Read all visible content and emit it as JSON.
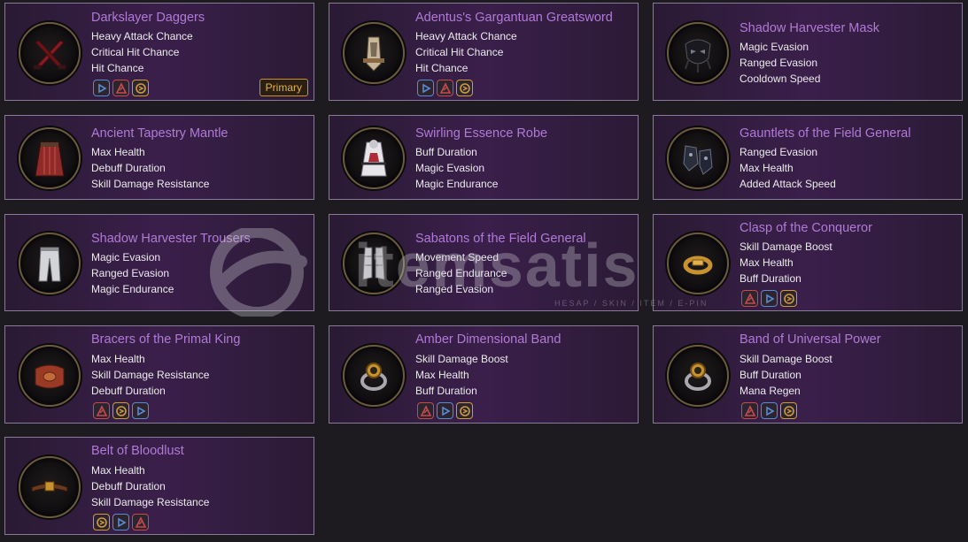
{
  "items": [
    {
      "name": "Darkslayer Daggers",
      "stats": [
        "Heavy Attack Chance",
        "Critical Hit Chance",
        "Hit Chance"
      ],
      "badges": [
        "blue",
        "red",
        "gold"
      ],
      "icon": "daggers-icon",
      "primary": "Primary"
    },
    {
      "name": "Adentus's Gargantuan Greatsword",
      "stats": [
        "Heavy Attack Chance",
        "Critical Hit Chance",
        "Hit Chance"
      ],
      "badges": [
        "blue",
        "red",
        "gold"
      ],
      "icon": "greatsword-icon"
    },
    {
      "name": "Shadow Harvester Mask",
      "stats": [
        "Magic Evasion",
        "Ranged Evasion",
        "Cooldown Speed"
      ],
      "badges": [],
      "icon": "mask-icon"
    },
    {
      "name": "Ancient Tapestry Mantle",
      "stats": [
        "Max Health",
        "Debuff Duration",
        "Skill Damage Resistance"
      ],
      "badges": [],
      "icon": "cloak-icon"
    },
    {
      "name": "Swirling Essence Robe",
      "stats": [
        "Buff Duration",
        "Magic Evasion",
        "Magic Endurance"
      ],
      "badges": [],
      "icon": "robe-icon"
    },
    {
      "name": "Gauntlets of the Field General",
      "stats": [
        "Ranged Evasion",
        "Max Health",
        "Added Attack Speed"
      ],
      "badges": [],
      "icon": "gauntlets-icon"
    },
    {
      "name": "Shadow Harvester Trousers",
      "stats": [
        "Magic Evasion",
        "Ranged Evasion",
        "Magic Endurance"
      ],
      "badges": [],
      "icon": "trousers-icon"
    },
    {
      "name": "Sabatons of the Field General",
      "stats": [
        "Movement Speed",
        "Ranged Endurance",
        "Ranged Evasion"
      ],
      "badges": [],
      "icon": "boots-icon"
    },
    {
      "name": "Clasp of the Conqueror",
      "stats": [
        "Skill Damage Boost",
        "Max Health",
        "Buff Duration"
      ],
      "badges": [
        "red",
        "blue",
        "gold"
      ],
      "icon": "bracelet-icon"
    },
    {
      "name": "Bracers of the Primal King",
      "stats": [
        "Max Health",
        "Skill Damage Resistance",
        "Debuff Duration"
      ],
      "badges": [
        "red",
        "gold",
        "blue"
      ],
      "icon": "bracer-icon"
    },
    {
      "name": "Amber Dimensional Band",
      "stats": [
        "Skill Damage Boost",
        "Max Health",
        "Buff Duration"
      ],
      "badges": [
        "red",
        "blue",
        "gold"
      ],
      "icon": "ring-icon"
    },
    {
      "name": "Band of Universal Power",
      "stats": [
        "Skill Damage Boost",
        "Buff Duration",
        "Mana Regen"
      ],
      "badges": [
        "red",
        "blue",
        "gold"
      ],
      "icon": "ring-icon"
    },
    {
      "name": "Belt of Bloodlust",
      "stats": [
        "Max Health",
        "Debuff Duration",
        "Skill Damage Resistance"
      ],
      "badges": [
        "gold",
        "blue",
        "red"
      ],
      "icon": "belt-icon"
    }
  ],
  "badge_colors": {
    "blue": "#5a8ad0",
    "red": "#c84a4a",
    "gold": "#d09a3a"
  },
  "watermark": {
    "text": "itemsatis",
    "sub": "HESAP / SKIN / ITEM / E-PIN"
  }
}
